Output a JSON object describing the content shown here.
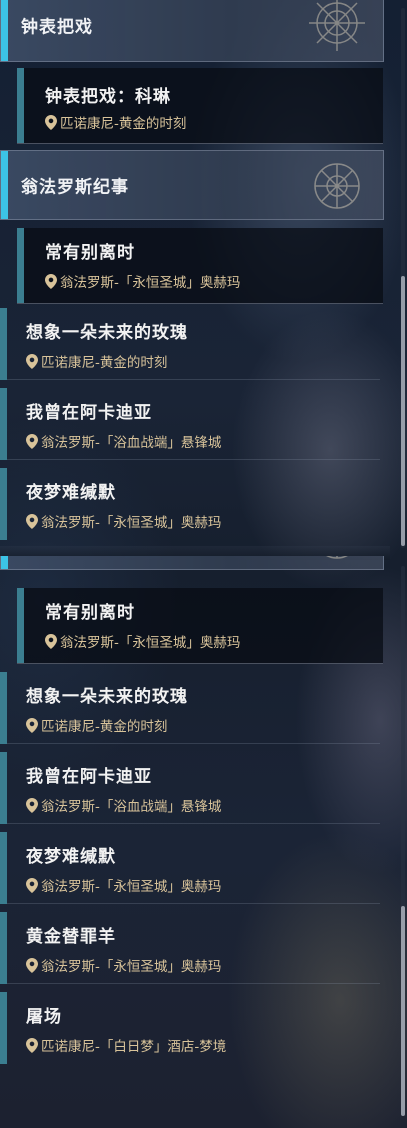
{
  "panel_a": {
    "section1": {
      "title": "钟表把戏"
    },
    "selected1": {
      "name": "钟表把戏：科琳",
      "location": "匹诺康尼-黄金的时刻"
    },
    "section2": {
      "title": "翁法罗斯纪事"
    },
    "selected2": {
      "name": "常有别离时",
      "location": "翁法罗斯-「永恒圣城」奥赫玛"
    },
    "items": [
      {
        "name": "想象一朵未来的玫瑰",
        "location": "匹诺康尼-黄金的时刻"
      },
      {
        "name": "我曾在阿卡迪亚",
        "location": "翁法罗斯-「浴血战端」悬锋城"
      },
      {
        "name": "夜梦难缄默",
        "location": "翁法罗斯-「永恒圣城」奥赫玛"
      }
    ]
  },
  "panel_b": {
    "selected": {
      "name": "常有别离时",
      "location": "翁法罗斯-「永恒圣城」奥赫玛"
    },
    "items": [
      {
        "name": "想象一朵未来的玫瑰",
        "location": "匹诺康尼-黄金的时刻"
      },
      {
        "name": "我曾在阿卡迪亚",
        "location": "翁法罗斯-「浴血战端」悬锋城"
      },
      {
        "name": "夜梦难缄默",
        "location": "翁法罗斯-「永恒圣城」奥赫玛"
      },
      {
        "name": "黄金替罪羊",
        "location": "翁法罗斯-「永恒圣城」奥赫玛"
      },
      {
        "name": "屠场",
        "location": "匹诺康尼-「白日梦」酒店-梦境"
      }
    ]
  },
  "icons": {
    "location": "map-pin-icon",
    "emblem": "faction-emblem-icon"
  },
  "colors": {
    "accent": "#3cc3e6",
    "entry_bar": "#3b7e90",
    "location_text": "#d8c39a"
  }
}
